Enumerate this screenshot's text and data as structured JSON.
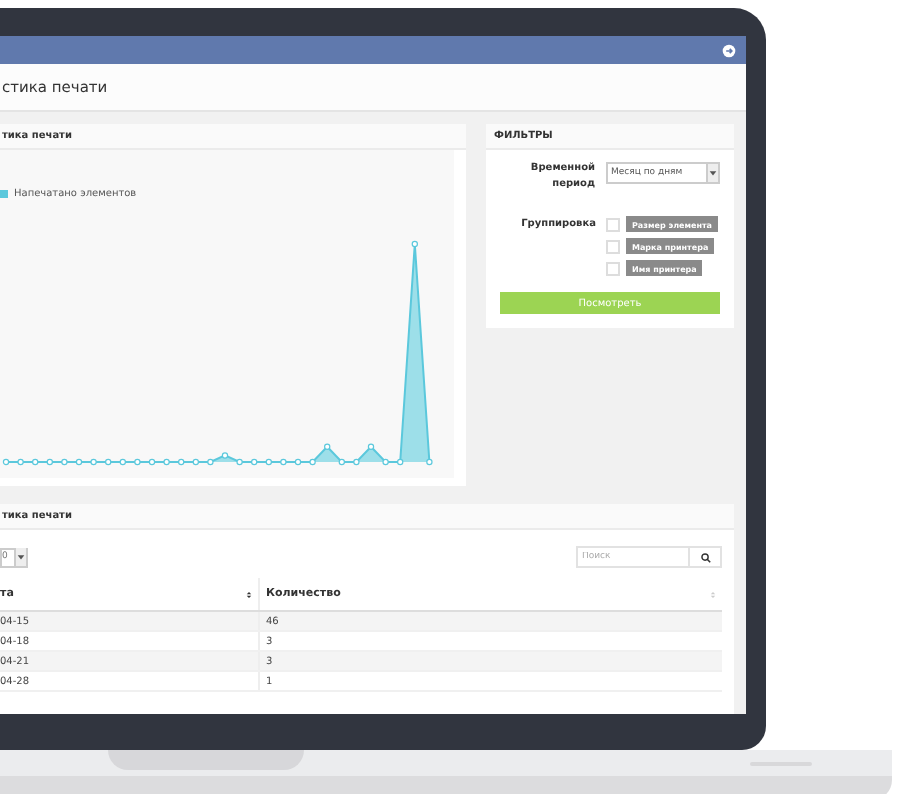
{
  "screen": {
    "page_title": "стика печати",
    "chart_panel": {
      "title": "тика печати",
      "legend": "Напечатано элементов"
    },
    "filters": {
      "title": "ФИЛЬТРЫ",
      "period_label": "Временной период",
      "period_value": "Месяц по дням",
      "grouping_label": "Группировка",
      "grouping_options": [
        {
          "label": "Размер элемента",
          "checked": false
        },
        {
          "label": "Марка принтера",
          "checked": false
        },
        {
          "label": "Имя принтера",
          "checked": false
        }
      ],
      "button": "Посмотреть"
    },
    "table_panel": {
      "title": "тика печати",
      "page_size": "0",
      "search": {
        "placeholder": "Поиск"
      },
      "columns": [
        "та",
        "Количество"
      ],
      "rows": [
        [
          "04-15",
          "46"
        ],
        [
          "04-18",
          "3"
        ],
        [
          "04-21",
          "3"
        ],
        [
          "04-28",
          "1"
        ]
      ]
    }
  }
}
